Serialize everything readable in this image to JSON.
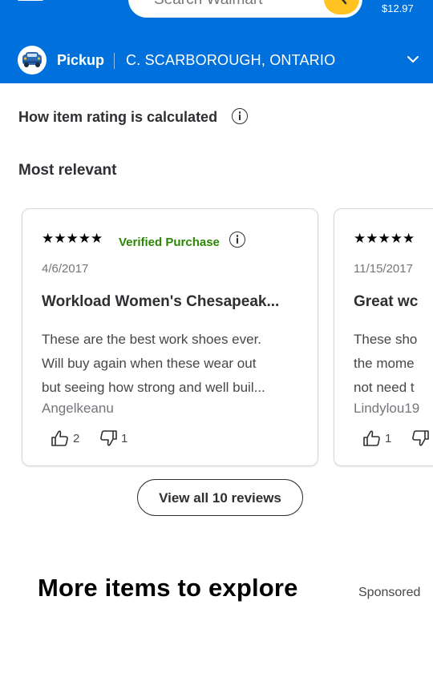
{
  "header": {
    "search_placeholder": "Search Walmart",
    "cart_total": "$12.97",
    "pickup_label": "Pickup",
    "pickup_location": "C. SCARBOROUGH, ONTARIO"
  },
  "ratings": {
    "how_calculated": "How item rating is calculated",
    "sort_label": "Most relevant"
  },
  "reviews": [
    {
      "rating": 5,
      "stars": "★★★★★",
      "verified": "Verified Purchase",
      "date": "4/6/2017",
      "title": "Workload Women's Chesapeak...",
      "text_lines": [
        "These are the best work shoes ever.",
        "Will buy again when these wear out",
        "but seeing how strong and well buil..."
      ],
      "author": "Angelkeanu",
      "helpful_count": "2",
      "unhelpful_count": "1"
    },
    {
      "rating": 5,
      "stars": "★★★★★",
      "date": "11/15/2017",
      "title": "Great wc",
      "text_lines": [
        "These sho",
        "the mome",
        "not need t"
      ],
      "author": "Lindylou19",
      "helpful_count": "1"
    }
  ],
  "view_all_label": "View all 10 reviews",
  "explore": {
    "title": "More items to explore",
    "sponsored": "Sponsored"
  },
  "colors": {
    "header_bg": "#0071dc",
    "spark_yellow": "#ffc220",
    "verified_green": "#2a8703"
  }
}
